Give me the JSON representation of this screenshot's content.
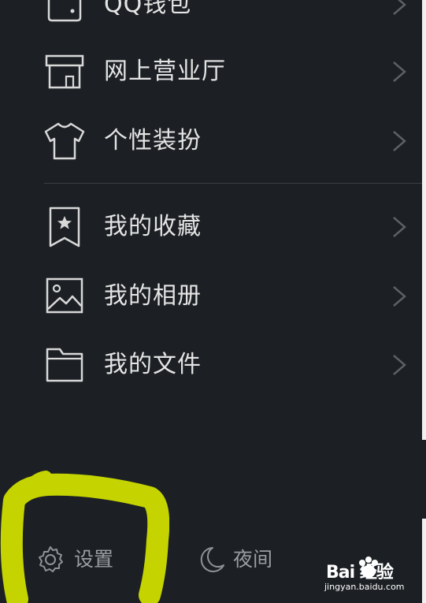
{
  "menu": {
    "items": [
      {
        "label": "QQ钱包",
        "icon": "wallet-icon"
      },
      {
        "label": "网上营业厅",
        "icon": "store-icon"
      },
      {
        "label": "个性装扮",
        "icon": "tshirt-icon"
      },
      {
        "label": "我的收藏",
        "icon": "bookmark-star-icon"
      },
      {
        "label": "我的相册",
        "icon": "image-icon"
      },
      {
        "label": "我的文件",
        "icon": "folder-icon"
      }
    ]
  },
  "bottom": {
    "settings_label": "设置",
    "night_label": "夜间"
  },
  "watermark": {
    "main": "Bai 经验",
    "sub": "jingyan.baidu.com"
  },
  "colors": {
    "background": "#1c2024",
    "text": "#e4e4e4",
    "icon_stroke": "#d8d8d8",
    "chevron": "#5c6166",
    "bottom_text": "#9a9ea2",
    "highlight": "#c5d400"
  }
}
